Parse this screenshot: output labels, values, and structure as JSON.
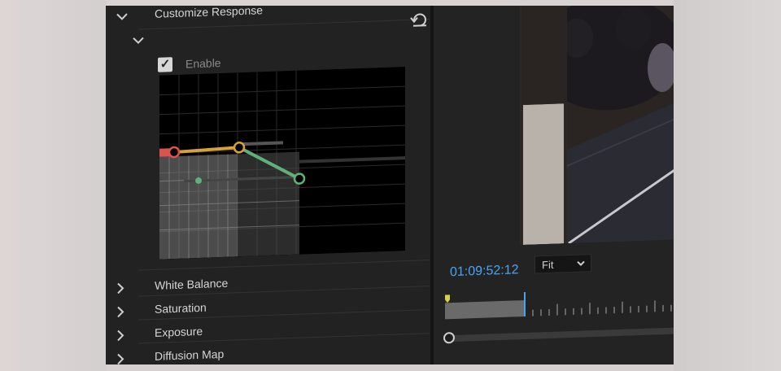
{
  "effect_controls": {
    "customize_response": {
      "title": "Customize Response"
    },
    "enable": {
      "label": "Enable",
      "checked": true,
      "check_glyph": "✓"
    },
    "reset_icon": "reset-icon",
    "sections": [
      {
        "label": "White Balance"
      },
      {
        "label": "Saturation"
      },
      {
        "label": "Exposure"
      },
      {
        "label": "Diffusion Map"
      }
    ],
    "curve_colors": {
      "red": "#d9534f",
      "yellow": "#d8a23a",
      "green": "#5fb07a"
    }
  },
  "program_monitor": {
    "timecode": "01:09:52:12",
    "zoom": "Fit",
    "dropdown_icon": "chevron-down-icon",
    "timecode_color": "#4aa3f2"
  },
  "icons": {
    "expanded": "chevron-down-icon",
    "collapsed": "chevron-right-icon"
  }
}
